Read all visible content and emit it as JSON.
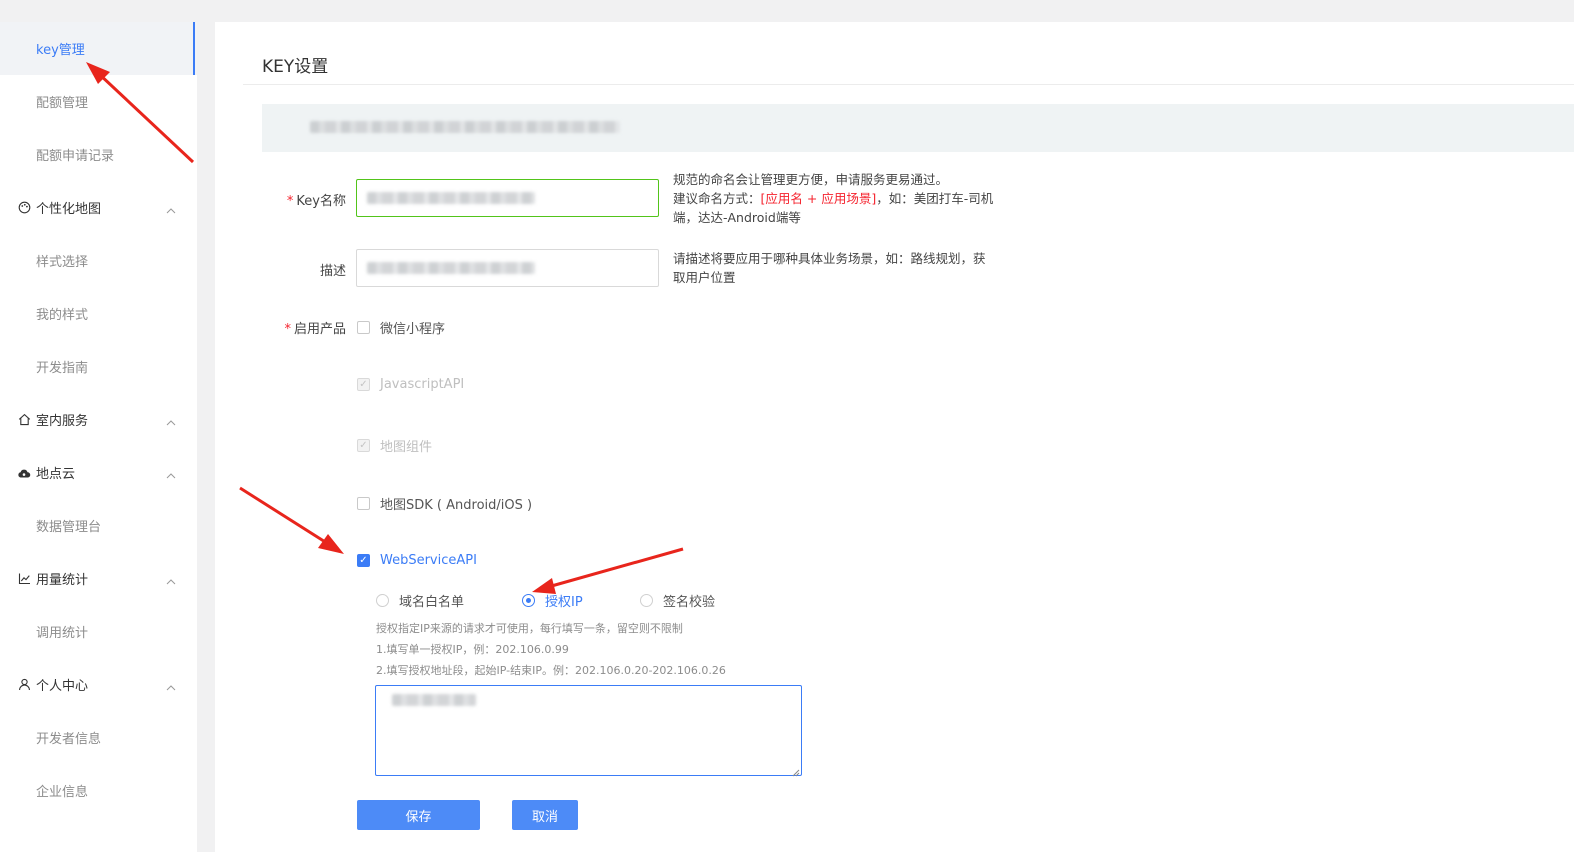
{
  "sidebar": {
    "items": [
      {
        "label": "key管理",
        "type": "item",
        "active": true
      },
      {
        "label": "配额管理",
        "type": "item"
      },
      {
        "label": "配额申请记录",
        "type": "item"
      },
      {
        "label": "个性化地图",
        "type": "group",
        "icon": "palette-icon"
      },
      {
        "label": "样式选择",
        "type": "item"
      },
      {
        "label": "我的样式",
        "type": "item"
      },
      {
        "label": "开发指南",
        "type": "item"
      },
      {
        "label": "室内服务",
        "type": "group",
        "icon": "home-icon"
      },
      {
        "label": "地点云",
        "type": "group",
        "icon": "cloud-icon"
      },
      {
        "label": "数据管理台",
        "type": "item"
      },
      {
        "label": "用量统计",
        "type": "group",
        "icon": "line-chart-icon"
      },
      {
        "label": "调用统计",
        "type": "item"
      },
      {
        "label": "个人中心",
        "type": "group",
        "icon": "user-icon"
      },
      {
        "label": "开发者信息",
        "type": "item"
      },
      {
        "label": "企业信息",
        "type": "item"
      }
    ]
  },
  "main": {
    "title": "KEY设置",
    "form": {
      "key_name": {
        "required_mark": "*",
        "label": "Key名称",
        "hint_line1": "规范的命名会让管理更方便，申请服务更易通过。",
        "hint_line2_prefix": "建议命名方式：",
        "hint_line2_highlight": "[应用名 + 应用场景]",
        "hint_line2_suffix": "，如：美团打车-司机",
        "hint_line3": "端，达达-Android端等"
      },
      "description": {
        "label": "描述",
        "hint_line1": "请描述将要应用于哪种具体业务场景，如：路线规划，获",
        "hint_line2": "取用户位置"
      },
      "products": {
        "required_mark": "*",
        "label": "启用产品",
        "options": [
          {
            "label": "微信小程序",
            "checked": false,
            "disabled": false
          },
          {
            "label": "JavascriptAPI",
            "checked": true,
            "disabled": true
          },
          {
            "label": "地图组件",
            "checked": true,
            "disabled": true
          },
          {
            "label": "地图SDK ( Android/iOS )",
            "checked": false,
            "disabled": false
          },
          {
            "label": "WebServiceAPI",
            "checked": true,
            "disabled": false
          }
        ]
      },
      "webservice_mode": {
        "options": [
          "域名白名单",
          "授权IP",
          "签名校验"
        ],
        "selected": "授权IP"
      },
      "ip_help": {
        "line1": "授权指定IP来源的请求才可使用，每行填写一条，留空则不限制",
        "line2": "1.填写单一授权IP，例：202.106.0.99",
        "line3": "2.填写授权地址段，起始IP-结束IP。例：202.106.0.20-202.106.0.26"
      }
    },
    "buttons": {
      "save": "保存",
      "cancel": "取消"
    }
  },
  "colors": {
    "accent": "#3b7cf6",
    "required": "#f5222d",
    "valid": "#52c41a",
    "annotation_arrow": "#e8251c"
  }
}
